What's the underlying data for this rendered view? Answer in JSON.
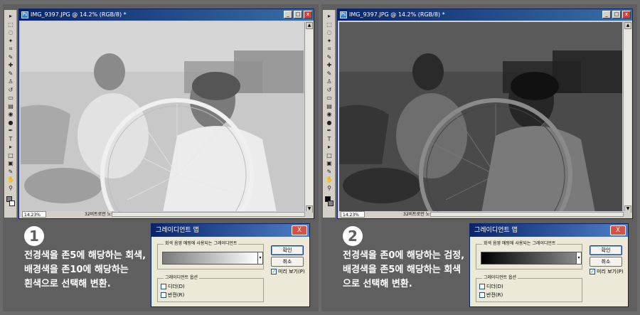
{
  "panels": [
    {
      "window_title": "IMG_9397.JPG @ 14.2% (RGB/8) *",
      "zoom": "14.23%",
      "doc_info": "32비트로만 노출 가능",
      "step_number": "1",
      "caption_lines": [
        "전경색을 존5에 해당하는 회색,",
        "배경색을 존10에 해당하는",
        "흰색으로 선택해 변환."
      ],
      "dialog": {
        "title": "그레이디언트 맵",
        "close_label": "X",
        "group_label": "회색 음영 매핑에 사용되는 그레이디언트",
        "options_label": "그레이디언트 옵션",
        "dither_label": "디더(D)",
        "reverse_label": "반전(R)",
        "ok_label": "확인",
        "cancel_label": "취소",
        "preview_label": "미리 보기(P)",
        "preview_checked": "✓",
        "gradient_start": "#7b7b7b",
        "gradient_end": "#ffffff"
      },
      "colors": {
        "foreground": "#808080",
        "background": "#ffffff"
      }
    },
    {
      "window_title": "IMG_9397.JPG @ 14.2% (RGB/8) *",
      "zoom": "14.23%",
      "doc_info": "32비트로만 노출 가능",
      "step_number": "2",
      "caption_lines": [
        "전경색을 존0에 해당하는 검정,",
        "배경색을 존5에 해당하는 회색",
        "으로 선택해 변환."
      ],
      "dialog": {
        "title": "그레이디언트 맵",
        "close_label": "X",
        "group_label": "회색 음영 매핑에 사용되는 그레이디언트",
        "options_label": "그레이디언트 옵션",
        "dither_label": "디더(D)",
        "reverse_label": "반전(R)",
        "ok_label": "확인",
        "cancel_label": "취소",
        "preview_label": "미리 보기(P)",
        "preview_checked": "✓",
        "gradient_start": "#000000",
        "gradient_end": "#8a8a8a"
      },
      "colors": {
        "foreground": "#000000",
        "background": "#808080"
      }
    }
  ],
  "window_buttons": {
    "minimize": "_",
    "maximize": "□",
    "close": "x"
  },
  "tool_icons": [
    "move-tool-icon",
    "marquee-tool-icon",
    "lasso-tool-icon",
    "magic-wand-tool-icon",
    "crop-tool-icon",
    "eyedropper-tool-icon",
    "healing-brush-tool-icon",
    "brush-tool-icon",
    "clone-stamp-tool-icon",
    "history-brush-tool-icon",
    "eraser-tool-icon",
    "gradient-tool-icon",
    "blur-tool-icon",
    "dodge-tool-icon",
    "pen-tool-icon",
    "type-tool-icon",
    "path-selection-tool-icon",
    "shape-tool-icon",
    "notes-tool-icon",
    "eyedropper2-tool-icon",
    "hand-tool-icon",
    "zoom-tool-icon"
  ]
}
